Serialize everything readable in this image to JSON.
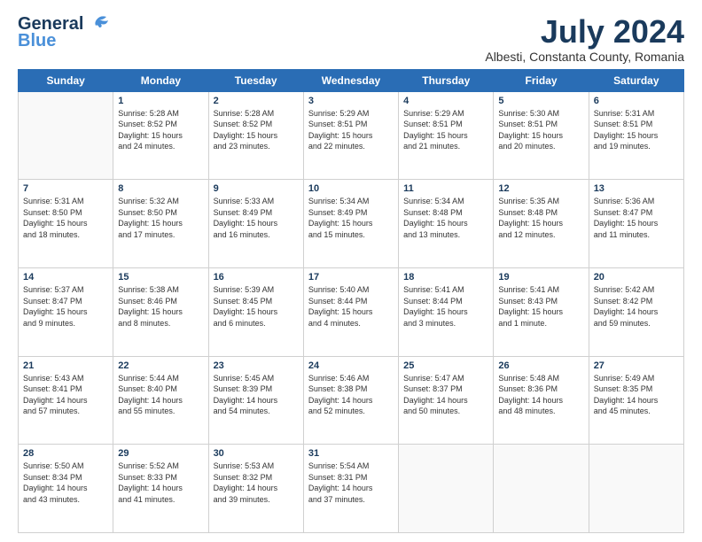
{
  "logo": {
    "line1": "General",
    "line2": "Blue"
  },
  "title": {
    "month_year": "July 2024",
    "location": "Albesti, Constanta County, Romania"
  },
  "header_days": [
    "Sunday",
    "Monday",
    "Tuesday",
    "Wednesday",
    "Thursday",
    "Friday",
    "Saturday"
  ],
  "weeks": [
    [
      {
        "day": "",
        "info": ""
      },
      {
        "day": "1",
        "info": "Sunrise: 5:28 AM\nSunset: 8:52 PM\nDaylight: 15 hours\nand 24 minutes."
      },
      {
        "day": "2",
        "info": "Sunrise: 5:28 AM\nSunset: 8:52 PM\nDaylight: 15 hours\nand 23 minutes."
      },
      {
        "day": "3",
        "info": "Sunrise: 5:29 AM\nSunset: 8:51 PM\nDaylight: 15 hours\nand 22 minutes."
      },
      {
        "day": "4",
        "info": "Sunrise: 5:29 AM\nSunset: 8:51 PM\nDaylight: 15 hours\nand 21 minutes."
      },
      {
        "day": "5",
        "info": "Sunrise: 5:30 AM\nSunset: 8:51 PM\nDaylight: 15 hours\nand 20 minutes."
      },
      {
        "day": "6",
        "info": "Sunrise: 5:31 AM\nSunset: 8:51 PM\nDaylight: 15 hours\nand 19 minutes."
      }
    ],
    [
      {
        "day": "7",
        "info": "Sunrise: 5:31 AM\nSunset: 8:50 PM\nDaylight: 15 hours\nand 18 minutes."
      },
      {
        "day": "8",
        "info": "Sunrise: 5:32 AM\nSunset: 8:50 PM\nDaylight: 15 hours\nand 17 minutes."
      },
      {
        "day": "9",
        "info": "Sunrise: 5:33 AM\nSunset: 8:49 PM\nDaylight: 15 hours\nand 16 minutes."
      },
      {
        "day": "10",
        "info": "Sunrise: 5:34 AM\nSunset: 8:49 PM\nDaylight: 15 hours\nand 15 minutes."
      },
      {
        "day": "11",
        "info": "Sunrise: 5:34 AM\nSunset: 8:48 PM\nDaylight: 15 hours\nand 13 minutes."
      },
      {
        "day": "12",
        "info": "Sunrise: 5:35 AM\nSunset: 8:48 PM\nDaylight: 15 hours\nand 12 minutes."
      },
      {
        "day": "13",
        "info": "Sunrise: 5:36 AM\nSunset: 8:47 PM\nDaylight: 15 hours\nand 11 minutes."
      }
    ],
    [
      {
        "day": "14",
        "info": "Sunrise: 5:37 AM\nSunset: 8:47 PM\nDaylight: 15 hours\nand 9 minutes."
      },
      {
        "day": "15",
        "info": "Sunrise: 5:38 AM\nSunset: 8:46 PM\nDaylight: 15 hours\nand 8 minutes."
      },
      {
        "day": "16",
        "info": "Sunrise: 5:39 AM\nSunset: 8:45 PM\nDaylight: 15 hours\nand 6 minutes."
      },
      {
        "day": "17",
        "info": "Sunrise: 5:40 AM\nSunset: 8:44 PM\nDaylight: 15 hours\nand 4 minutes."
      },
      {
        "day": "18",
        "info": "Sunrise: 5:41 AM\nSunset: 8:44 PM\nDaylight: 15 hours\nand 3 minutes."
      },
      {
        "day": "19",
        "info": "Sunrise: 5:41 AM\nSunset: 8:43 PM\nDaylight: 15 hours\nand 1 minute."
      },
      {
        "day": "20",
        "info": "Sunrise: 5:42 AM\nSunset: 8:42 PM\nDaylight: 14 hours\nand 59 minutes."
      }
    ],
    [
      {
        "day": "21",
        "info": "Sunrise: 5:43 AM\nSunset: 8:41 PM\nDaylight: 14 hours\nand 57 minutes."
      },
      {
        "day": "22",
        "info": "Sunrise: 5:44 AM\nSunset: 8:40 PM\nDaylight: 14 hours\nand 55 minutes."
      },
      {
        "day": "23",
        "info": "Sunrise: 5:45 AM\nSunset: 8:39 PM\nDaylight: 14 hours\nand 54 minutes."
      },
      {
        "day": "24",
        "info": "Sunrise: 5:46 AM\nSunset: 8:38 PM\nDaylight: 14 hours\nand 52 minutes."
      },
      {
        "day": "25",
        "info": "Sunrise: 5:47 AM\nSunset: 8:37 PM\nDaylight: 14 hours\nand 50 minutes."
      },
      {
        "day": "26",
        "info": "Sunrise: 5:48 AM\nSunset: 8:36 PM\nDaylight: 14 hours\nand 48 minutes."
      },
      {
        "day": "27",
        "info": "Sunrise: 5:49 AM\nSunset: 8:35 PM\nDaylight: 14 hours\nand 45 minutes."
      }
    ],
    [
      {
        "day": "28",
        "info": "Sunrise: 5:50 AM\nSunset: 8:34 PM\nDaylight: 14 hours\nand 43 minutes."
      },
      {
        "day": "29",
        "info": "Sunrise: 5:52 AM\nSunset: 8:33 PM\nDaylight: 14 hours\nand 41 minutes."
      },
      {
        "day": "30",
        "info": "Sunrise: 5:53 AM\nSunset: 8:32 PM\nDaylight: 14 hours\nand 39 minutes."
      },
      {
        "day": "31",
        "info": "Sunrise: 5:54 AM\nSunset: 8:31 PM\nDaylight: 14 hours\nand 37 minutes."
      },
      {
        "day": "",
        "info": ""
      },
      {
        "day": "",
        "info": ""
      },
      {
        "day": "",
        "info": ""
      }
    ]
  ]
}
